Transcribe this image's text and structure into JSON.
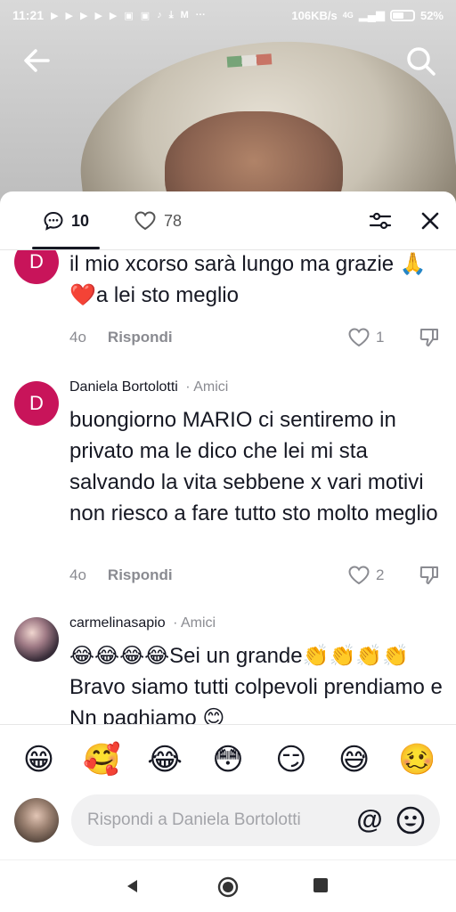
{
  "status_bar": {
    "time": "11:21",
    "speed": "106KB/s",
    "network": "4G",
    "battery": "52%"
  },
  "comments_header": {
    "comments_count": "10",
    "likes_count": "78"
  },
  "comments": [
    {
      "text": "il mio xcorso sarà lungo ma grazie 🙏❤️a lei sto meglio",
      "age": "4o",
      "reply_label": "Rispondi",
      "likes": "1",
      "avatar_letter": "D"
    },
    {
      "author": "Daniela Bortolotti",
      "relation": "· Amici",
      "text": "buongiorno MARIO ci sentiremo in privato ma le dico che lei mi sta salvando la vita sebbene x vari motivi non riesco a fare tutto sto molto meglio",
      "age": "4o",
      "reply_label": "Rispondi",
      "likes": "2",
      "avatar_letter": "D"
    },
    {
      "author": "carmelinasapio",
      "relation": "· Amici",
      "text": "😂😂😂😂Sei un grande👏👏👏👏Bravo siamo tutti colpevoli prendiamo e Nn paghiamo 😊"
    }
  ],
  "emoji_bar": [
    "😁",
    "🥰",
    "😂",
    "😳",
    "😏",
    "😅",
    "🥴"
  ],
  "reply_input": {
    "placeholder": "Rispondi a Daniela Bortolotti",
    "at_label": "@"
  }
}
